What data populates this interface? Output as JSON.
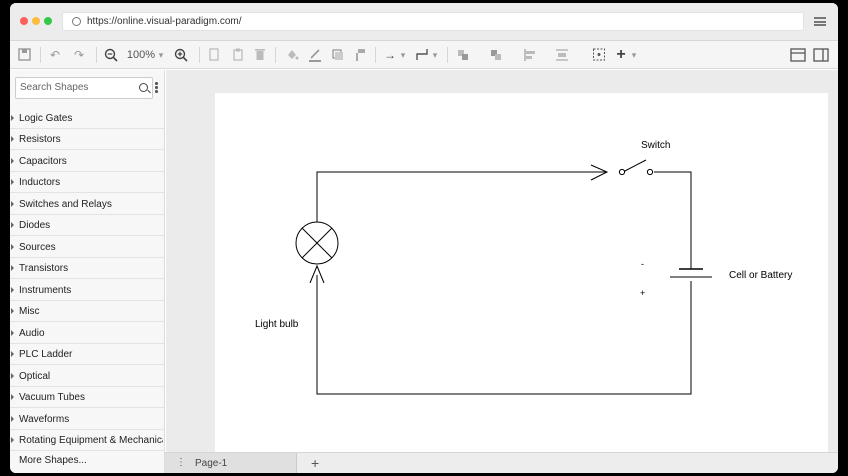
{
  "browser": {
    "url": "https://online.visual-paradigm.com/"
  },
  "toolbar": {
    "zoom": "100%",
    "zoom_caret": "▾",
    "undo": "↶",
    "redo": "↷",
    "zoom_out": "⊖",
    "zoom_in": "⊕",
    "arrow": "→",
    "plus": "+"
  },
  "sidebar": {
    "search_placeholder": "Search Shapes",
    "categories": [
      "Logic Gates",
      "Resistors",
      "Capacitors",
      "Inductors",
      "Switches and Relays",
      "Diodes",
      "Sources",
      "Transistors",
      "Instruments",
      "Misc",
      "Audio",
      "PLC Ladder",
      "Optical",
      "Vacuum Tubes",
      "Waveforms",
      "Rotating Equipment & Mechanica..."
    ],
    "more": "More Shapes..."
  },
  "diagram": {
    "switch_label": "Switch",
    "battery_label": "Cell or Battery",
    "bulb_label": "Light bulb",
    "minus_sign": "-",
    "plus_sign": "+"
  },
  "bottom": {
    "page_tab": "Page-1",
    "tab_menu": "⋮",
    "add_page": "+"
  }
}
